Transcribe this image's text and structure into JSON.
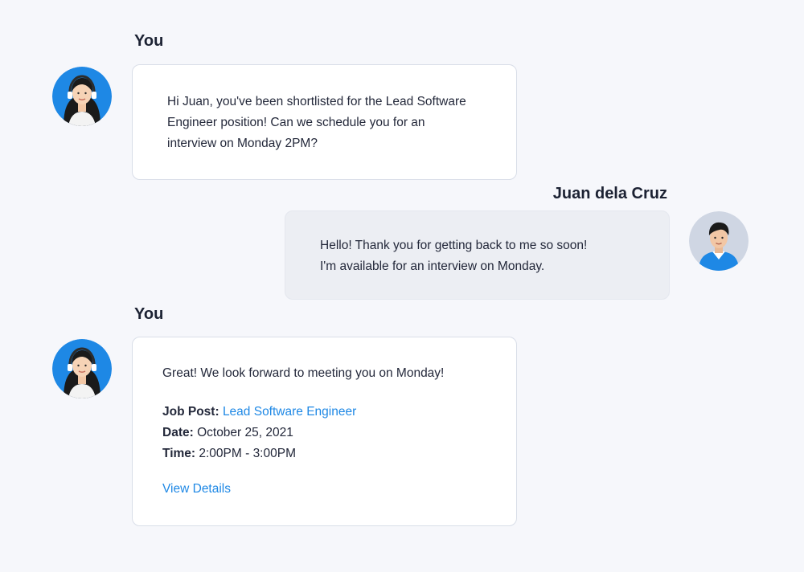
{
  "messages": [
    {
      "sender": "You",
      "lines": [
        "Hi Juan, you've been shortlisted for the Lead Software",
        "Engineer position! Can we schedule you for an",
        "interview on Monday 2PM?"
      ],
      "avatar_icon": "recruiter-avatar-icon"
    },
    {
      "sender": "Juan dela Cruz",
      "lines": [
        "Hello! Thank you for getting back to me so soon!",
        "I'm available for an interview on Monday."
      ],
      "avatar_icon": "candidate-avatar-icon"
    },
    {
      "sender": "You",
      "lines": [
        "Great! We look forward to meeting you on Monday!"
      ],
      "details": {
        "job_post_label": "Job Post:",
        "job_post_value": "Lead Software Engineer",
        "date_label": "Date:",
        "date_value": "October 25, 2021",
        "time_label": "Time:",
        "time_value": "2:00PM - 3:00PM"
      },
      "action_label": "View Details",
      "avatar_icon": "recruiter-avatar-icon"
    }
  ],
  "colors": {
    "background": "#f6f7fb",
    "accent": "#1e88e5",
    "avatar_blue": "#1e88e5",
    "incoming_bubble": "#ffffff",
    "outgoing_bubble": "#eceef3"
  }
}
